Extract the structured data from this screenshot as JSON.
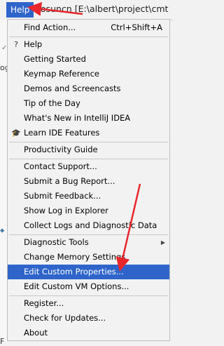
{
  "menubar": {
    "help_label": "Help",
    "path_text": "gosuncn [E:\\albert\\project\\cmt"
  },
  "gutter": {
    "frag_a": "✓",
    "frag_b": "og",
    "frag_c": "⬥",
    "frag_d": "F"
  },
  "menu": {
    "find_action": {
      "label": "Find Action...",
      "shortcut": "Ctrl+Shift+A"
    },
    "help": {
      "label": "Help",
      "icon": "?"
    },
    "getting_started": "Getting Started",
    "keymap_reference": "Keymap Reference",
    "demos": "Demos and Screencasts",
    "tip_of_day": "Tip of the Day",
    "whats_new": "What's New in IntelliJ IDEA",
    "learn_ide": {
      "label": "Learn IDE Features",
      "icon": "🎓"
    },
    "productivity": "Productivity Guide",
    "contact_support": "Contact Support...",
    "submit_bug": "Submit a Bug Report...",
    "submit_feedback": "Submit Feedback...",
    "show_log": "Show Log in Explorer",
    "collect_logs": "Collect Logs and Diagnostic Data",
    "diagnostic_tools": "Diagnostic Tools",
    "change_memory": "Change Memory Settings",
    "edit_custom_properties": "Edit Custom Properties...",
    "edit_custom_vm": "Edit Custom VM Options...",
    "register": "Register...",
    "check_updates": "Check for Updates...",
    "about": "About"
  },
  "colors": {
    "selection": "#2f65ca",
    "annotation": "#e8262c"
  }
}
